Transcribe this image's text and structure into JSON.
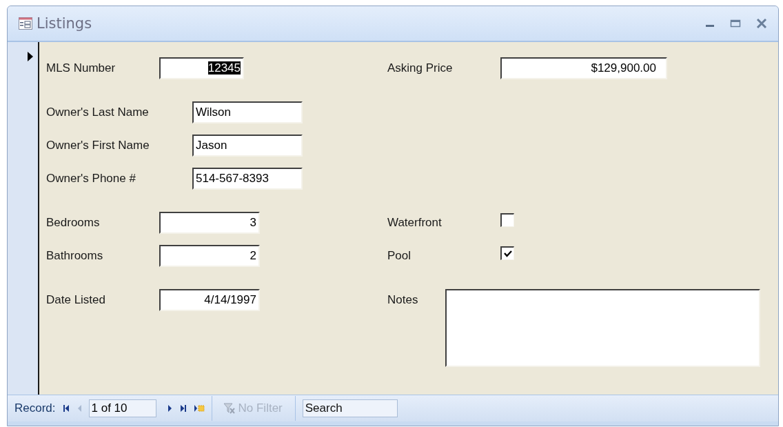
{
  "window": {
    "title": "Listings"
  },
  "record_selector": {
    "current": true
  },
  "rows": [
    {
      "left": {
        "label": "MLS Number",
        "value": "12345",
        "kind": "number",
        "highlighted": true
      },
      "right": {
        "label": "Asking Price",
        "value": "$129,900.00",
        "kind": "number",
        "highlighted": false
      }
    },
    {
      "left": {
        "label": "Owner's Last Name",
        "value": "Wilson",
        "kind": "text",
        "highlighted": false
      }
    },
    {
      "left": {
        "label": "Owner's First Name",
        "value": "Jason",
        "kind": "text",
        "highlighted": false
      }
    },
    {
      "left": {
        "label": "Owner's Phone #",
        "value": "514-567-8393",
        "kind": "text",
        "highlighted": false
      }
    },
    {
      "left": {
        "label": "Bedrooms",
        "value": "3",
        "kind": "number",
        "highlighted": false
      },
      "right": {
        "label": "Waterfront",
        "kind": "checkbox",
        "checked": false
      }
    },
    {
      "left": {
        "label": "Bathrooms",
        "value": "2",
        "kind": "number",
        "highlighted": false
      },
      "right": {
        "label": "Pool",
        "kind": "checkbox",
        "checked": true
      }
    },
    {
      "left": {
        "label": "Date Listed",
        "value": "4/14/1997",
        "kind": "number",
        "highlighted": false
      },
      "right": {
        "label": "Notes",
        "kind": "memo"
      }
    }
  ],
  "navigation": {
    "label": "Record:",
    "position": "1 of 10",
    "filter": {
      "label": "No Filter",
      "disabled": true
    },
    "search": {
      "placeholder": "Search"
    }
  }
}
